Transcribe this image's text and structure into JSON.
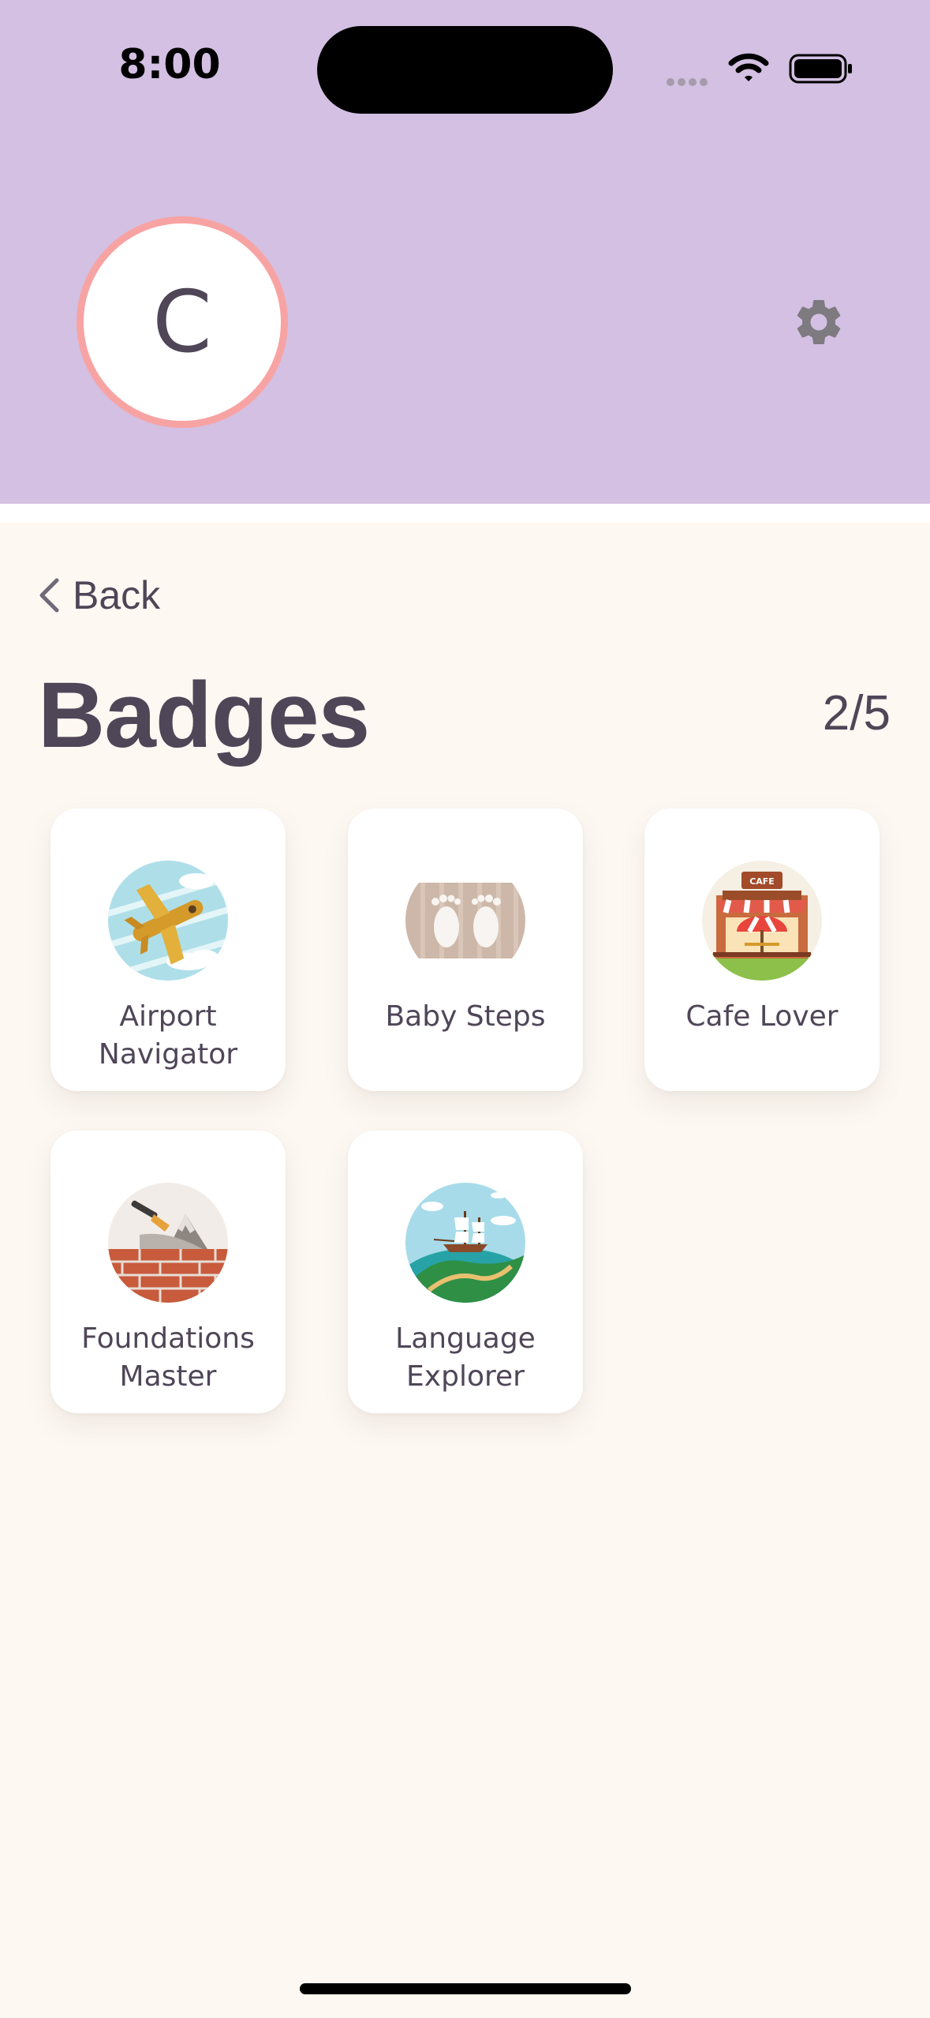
{
  "status_bar": {
    "time": "8:00"
  },
  "profile": {
    "avatar_initial": "C"
  },
  "nav": {
    "back_label": "Back"
  },
  "page": {
    "title": "Badges",
    "count": "2/5"
  },
  "badges": [
    {
      "name": "Airport Navigator",
      "icon": "airplane-badge-icon"
    },
    {
      "name": "Baby Steps",
      "icon": "footprints-badge-icon"
    },
    {
      "name": "Cafe Lover",
      "icon": "cafe-badge-icon",
      "sign": "CAFE"
    },
    {
      "name": "Foundations Master",
      "icon": "brick-wall-badge-icon"
    },
    {
      "name": "Language Explorer",
      "icon": "ship-globe-badge-icon"
    }
  ],
  "colors": {
    "header": "#d3c0e3",
    "background": "#fdf8f2",
    "avatar_ring": "#f8a3a3",
    "text": "#4f4658"
  }
}
